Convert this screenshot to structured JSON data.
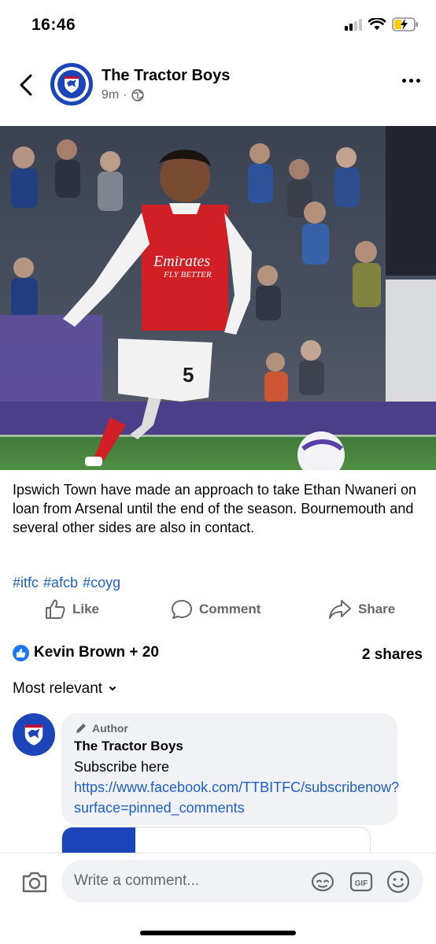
{
  "status_bar": {
    "time": "16:46"
  },
  "header": {
    "page_name": "The Tractor Boys",
    "time_ago": "9m",
    "separator": "·"
  },
  "post": {
    "text": "Ipswich Town have made an approach to take Ethan Nwaneri on loan from Arsenal until the end of the season. Bournemouth and several other sides are also in contact.",
    "hashtags": [
      "#itfc",
      "#afcb",
      "#coyg"
    ]
  },
  "photo": {
    "sponsor_line1": "Emirates",
    "sponsor_line2": "FLY BETTER",
    "shirt_number": "5"
  },
  "actions": {
    "like": "Like",
    "comment": "Comment",
    "share": "Share"
  },
  "engagement": {
    "reactors": "Kevin Brown + 20",
    "shares": "2 shares"
  },
  "comments": {
    "sort_label": "Most relevant",
    "items": [
      {
        "tag": "Author",
        "name": "The Tractor Boys",
        "text_prefix": "Subscribe here ",
        "link": "https://www.facebook.com/TTBITFC/subscribenow?surface=pinned_comments"
      }
    ]
  },
  "composer": {
    "placeholder": "Write a comment..."
  },
  "colors": {
    "brand_blue": "#1b45b9",
    "link_blue": "#1d5fc9",
    "facebook_blue": "#1877f2",
    "muted_text": "#65676b",
    "bubble_bg": "#f0f2f5"
  },
  "icons": {
    "back": "chevron-left-icon",
    "more": "more-horizontal-icon",
    "privacy": "globe-icon",
    "like": "thumbs-up-icon",
    "comment": "speech-bubble-icon",
    "share": "share-arrow-icon",
    "camera": "camera-icon",
    "avatar_sticker": "avatar-sticker-icon",
    "gif": "gif-icon",
    "emoji": "smiley-icon",
    "author": "pencil-icon"
  }
}
